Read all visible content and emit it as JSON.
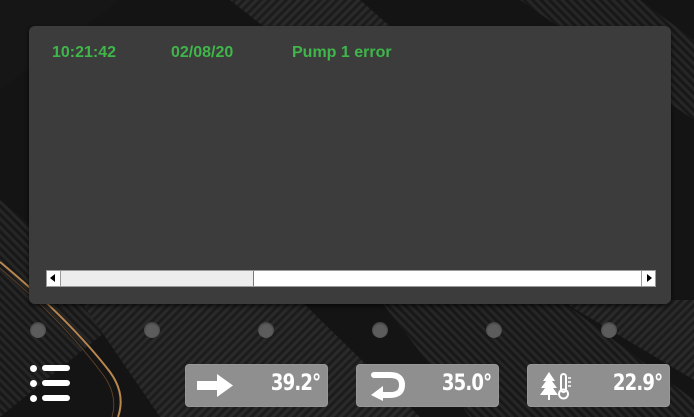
{
  "log": {
    "entries": [
      {
        "time": "10:21:42",
        "date": "02/08/20",
        "message": "Pump 1 error"
      }
    ]
  },
  "pager": {
    "page_count": 6,
    "active_page": null
  },
  "menu": {
    "icon": "menu-list-icon"
  },
  "status": {
    "supply": {
      "icon": "arrow-right-icon",
      "value": "39.2°"
    },
    "return": {
      "icon": "return-arrow-icon",
      "value": "35.0°"
    },
    "outdoor": {
      "icon": "tree-thermometer-icon",
      "value": "22.9°"
    }
  },
  "colors": {
    "log_text": "#3fb64a",
    "panel": "#3c3c3c",
    "tile": "#8f8f8f",
    "accent_curve": "#b8864e"
  }
}
